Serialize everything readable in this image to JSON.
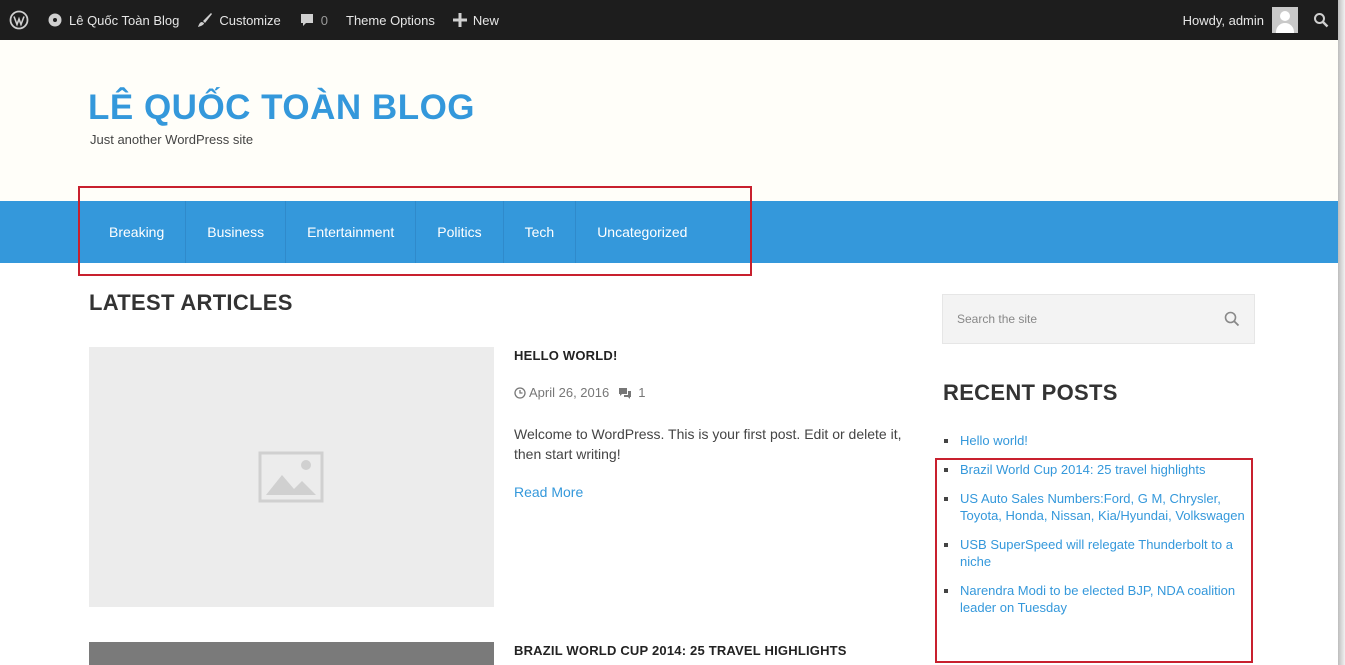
{
  "adminbar": {
    "wp_logo_icon": "wordpress-logo-icon",
    "site_name": "Lê Quốc Toàn Blog",
    "customize": "Customize",
    "comments_count": "0",
    "theme_options": "Theme Options",
    "new": "New",
    "howdy": "Howdy, admin"
  },
  "header": {
    "title": "LÊ QUỐC TOÀN BLOG",
    "tagline": "Just another WordPress site"
  },
  "nav": {
    "items": [
      "Breaking",
      "Business",
      "Entertainment",
      "Politics",
      "Tech",
      "Uncategorized"
    ]
  },
  "main": {
    "section_title": "LATEST ARTICLES",
    "posts": [
      {
        "title": "HELLO WORLD!",
        "date": "April 26, 2016",
        "comments": "1",
        "excerpt": "Welcome to WordPress. This is your first post. Edit or delete it, then start writing!",
        "read_more": "Read More"
      },
      {
        "title": "BRAZIL WORLD CUP 2014: 25 TRAVEL HIGHLIGHTS"
      }
    ]
  },
  "sidebar": {
    "search_placeholder": "Search the site",
    "recent_title": "RECENT POSTS",
    "recent_posts": [
      "Hello world!",
      "Brazil World Cup 2014: 25 travel highlights",
      "US Auto Sales Numbers:Ford, G M, Chrysler, Toyota, Honda, Nissan, Kia/Hyundai, Volkswagen",
      "USB SuperSpeed will relegate Thunderbolt to a niche",
      "Narendra Modi to be elected BJP, NDA coalition leader on Tuesday"
    ]
  },
  "colors": {
    "accent": "#3498db",
    "adminbar": "#1d1d1d",
    "highlight": "#c8202e"
  }
}
